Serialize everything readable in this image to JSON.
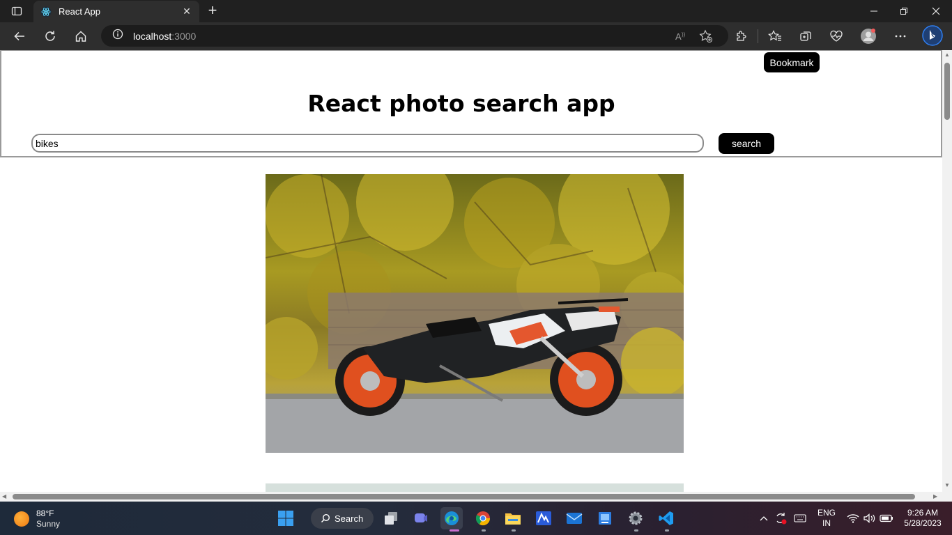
{
  "browser": {
    "tab_title": "React App",
    "url_host": "localhost",
    "url_port": ":3000"
  },
  "tooltip": "Bookmark",
  "app": {
    "title": "React photo search app",
    "search_value": "bikes",
    "search_button": "search"
  },
  "taskbar": {
    "weather_temp": "88°F",
    "weather_condition": "Sunny",
    "search_label": "Search",
    "lang_line1": "ENG",
    "lang_line2": "IN",
    "time": "9:26 AM",
    "date": "5/28/2023"
  }
}
